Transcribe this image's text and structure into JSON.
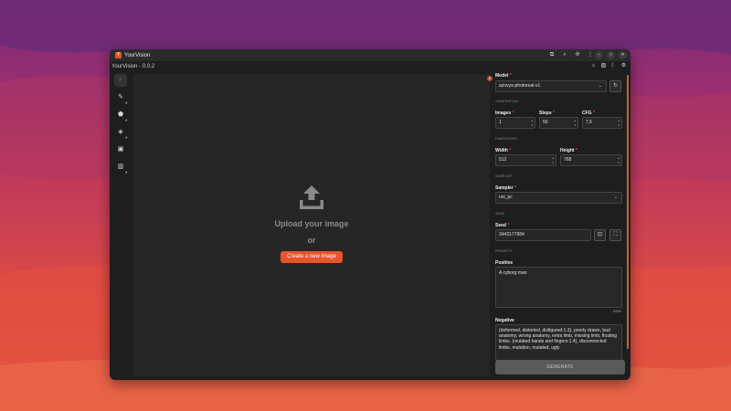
{
  "app": {
    "name": "YourVision",
    "version": "YourVision - 0.0.2",
    "logo_letter": "Y"
  },
  "titlebar_icons": [
    "translate-icon",
    "search-icon",
    "puzzle-icon",
    "more-icon"
  ],
  "window_controls": [
    "minimize",
    "maximize",
    "close"
  ],
  "sub_icons": [
    "home-icon",
    "image-icon",
    "moon-icon",
    "gear-icon"
  ],
  "tools": [
    {
      "name": "search",
      "glyph": "🔍"
    },
    {
      "name": "brush",
      "glyph": "✎"
    },
    {
      "name": "eraser",
      "glyph": "⌫"
    },
    {
      "name": "fill",
      "glyph": "◆"
    },
    {
      "name": "save",
      "glyph": "▣"
    },
    {
      "name": "delete",
      "glyph": "🗑"
    }
  ],
  "canvas": {
    "upload_text": "Upload your image",
    "or_text": "or",
    "create_button": "Create a new image"
  },
  "panel": {
    "model_label": "Model",
    "model_value": "azovya-photoreal-v1",
    "generation_section": "GENERATION",
    "images_label": "Images",
    "images_value": "1",
    "steps_label": "Steps",
    "steps_value": "50",
    "cfg_label": "CFG",
    "cfg_value": "7,5",
    "dimensions_section": "DIMENSIONS",
    "width_label": "Width",
    "width_value": "512",
    "height_label": "Height",
    "height_value": "768",
    "sampler_section": "SAMPLER",
    "sampler_label": "Sampler",
    "sampler_value": "uni_pc",
    "seed_section": "SEED",
    "seed_label": "Seed",
    "seed_value": "3443177984",
    "prompts_section": "PROMPTS",
    "positive_label": "Positive",
    "positive_value": "A cyborg man",
    "positive_count": "0/300",
    "negative_label": "Negative",
    "negative_value": "(deformed, distorted, disfigured:1.3), poorly drawn, bad anatomy, wrong anatomy, extra limb, missing limb, floating limbs, (mutated hands and fingers:1.4), disconnected limbs, mutation, mutated, ugly",
    "generate_button": "GENERATE"
  },
  "colors": {
    "accent": "#e8542b",
    "window_bg": "#1e1e1f",
    "canvas_bg": "#262627"
  }
}
